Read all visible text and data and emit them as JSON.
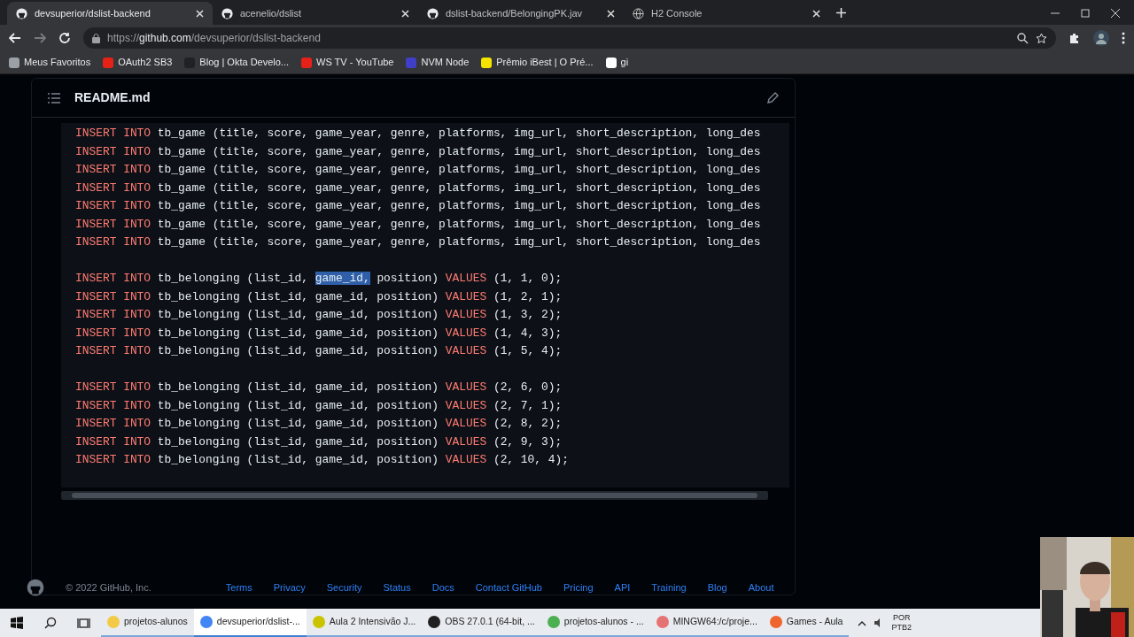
{
  "tabs": [
    {
      "title": "devsuperior/dslist-backend",
      "selected": true
    },
    {
      "title": "acenelio/dslist",
      "selected": false
    },
    {
      "title": "dslist-backend/BelongingPK.jav",
      "selected": false
    },
    {
      "title": "H2 Console",
      "selected": false
    }
  ],
  "address": {
    "scheme": "https://",
    "host": "github.com",
    "path": "/devsuperior/dslist-backend"
  },
  "bookmarks": [
    {
      "label": "Meus Favoritos",
      "color": "#9aa0a6"
    },
    {
      "label": "OAuth2 SB3",
      "color": "#e62117"
    },
    {
      "label": "Blog | Okta Develo...",
      "color": "#202124"
    },
    {
      "label": "WS TV - YouTube",
      "color": "#e62117"
    },
    {
      "label": "NVM Node",
      "color": "#3f3fc8"
    },
    {
      "label": "Prêmio iBest | O Pré...",
      "color": "#f5e400"
    },
    {
      "label": "gi",
      "color": "#ffffff"
    }
  ],
  "readme": {
    "title": "README.md",
    "blocks": [
      [
        [
          {
            "t": "INSERT INTO",
            "kind": "keyword"
          },
          {
            "t": " tb_game (title, score, game_year, genre, platforms, img_url, short_description, long_des",
            "kind": "plain"
          }
        ],
        [
          {
            "t": "INSERT INTO",
            "kind": "keyword"
          },
          {
            "t": " tb_game (title, score, game_year, genre, platforms, img_url, short_description, long_des",
            "kind": "plain"
          }
        ],
        [
          {
            "t": "INSERT INTO",
            "kind": "keyword"
          },
          {
            "t": " tb_game (title, score, game_year, genre, platforms, img_url, short_description, long_des",
            "kind": "plain"
          }
        ],
        [
          {
            "t": "INSERT INTO",
            "kind": "keyword"
          },
          {
            "t": " tb_game (title, score, game_year, genre, platforms, img_url, short_description, long_des",
            "kind": "plain"
          }
        ],
        [
          {
            "t": "INSERT INTO",
            "kind": "keyword"
          },
          {
            "t": " tb_game (title, score, game_year, genre, platforms, img_url, short_description, long_des",
            "kind": "plain"
          }
        ],
        [
          {
            "t": "INSERT INTO",
            "kind": "keyword"
          },
          {
            "t": " tb_game (title, score, game_year, genre, platforms, img_url, short_description, long_des",
            "kind": "plain"
          }
        ],
        [
          {
            "t": "INSERT INTO",
            "kind": "keyword"
          },
          {
            "t": " tb_game (title, score, game_year, genre, platforms, img_url, short_description, long_des",
            "kind": "plain"
          }
        ]
      ],
      [
        [
          {
            "t": "INSERT INTO",
            "kind": "keyword"
          },
          {
            "t": " tb_belonging (list_id, ",
            "kind": "plain"
          },
          {
            "t": "game_id,",
            "kind": "selected"
          },
          {
            "t": " position) ",
            "kind": "plain"
          },
          {
            "t": "VALUES",
            "kind": "keyword"
          },
          {
            "t": " (1, 1, 0);",
            "kind": "plain"
          }
        ],
        [
          {
            "t": "INSERT INTO",
            "kind": "keyword"
          },
          {
            "t": " tb_belonging (list_id, game_id, position) ",
            "kind": "plain"
          },
          {
            "t": "VALUES",
            "kind": "keyword"
          },
          {
            "t": " (1, 2, 1);",
            "kind": "plain"
          }
        ],
        [
          {
            "t": "INSERT INTO",
            "kind": "keyword"
          },
          {
            "t": " tb_belonging (list_id, game_id, position) ",
            "kind": "plain"
          },
          {
            "t": "VALUES",
            "kind": "keyword"
          },
          {
            "t": " (1, 3, 2);",
            "kind": "plain"
          }
        ],
        [
          {
            "t": "INSERT INTO",
            "kind": "keyword"
          },
          {
            "t": " tb_belonging (list_id, game_id, position) ",
            "kind": "plain"
          },
          {
            "t": "VALUES",
            "kind": "keyword"
          },
          {
            "t": " (1, 4, 3);",
            "kind": "plain"
          }
        ],
        [
          {
            "t": "INSERT INTO",
            "kind": "keyword"
          },
          {
            "t": " tb_belonging (list_id, game_id, position) ",
            "kind": "plain"
          },
          {
            "t": "VALUES",
            "kind": "keyword"
          },
          {
            "t": " (1, 5, 4);",
            "kind": "plain"
          }
        ]
      ],
      [
        [
          {
            "t": "INSERT INTO",
            "kind": "keyword"
          },
          {
            "t": " tb_belonging (list_id, game_id, position) ",
            "kind": "plain"
          },
          {
            "t": "VALUES",
            "kind": "keyword"
          },
          {
            "t": " (2, 6, 0);",
            "kind": "plain"
          }
        ],
        [
          {
            "t": "INSERT INTO",
            "kind": "keyword"
          },
          {
            "t": " tb_belonging (list_id, game_id, position) ",
            "kind": "plain"
          },
          {
            "t": "VALUES",
            "kind": "keyword"
          },
          {
            "t": " (2, 7, 1);",
            "kind": "plain"
          }
        ],
        [
          {
            "t": "INSERT INTO",
            "kind": "keyword"
          },
          {
            "t": " tb_belonging (list_id, game_id, position) ",
            "kind": "plain"
          },
          {
            "t": "VALUES",
            "kind": "keyword"
          },
          {
            "t": " (2, 8, 2);",
            "kind": "plain"
          }
        ],
        [
          {
            "t": "INSERT INTO",
            "kind": "keyword"
          },
          {
            "t": " tb_belonging (list_id, game_id, position) ",
            "kind": "plain"
          },
          {
            "t": "VALUES",
            "kind": "keyword"
          },
          {
            "t": " (2, 9, 3);",
            "kind": "plain"
          }
        ],
        [
          {
            "t": "INSERT INTO",
            "kind": "keyword"
          },
          {
            "t": " tb_belonging (list_id, game_id, position) ",
            "kind": "plain"
          },
          {
            "t": "VALUES",
            "kind": "keyword"
          },
          {
            "t": " (2, 10, 4);",
            "kind": "plain"
          }
        ]
      ]
    ]
  },
  "footer": {
    "copyright": "© 2022 GitHub, Inc.",
    "links": [
      "Terms",
      "Privacy",
      "Security",
      "Status",
      "Docs",
      "Contact GitHub",
      "Pricing",
      "API",
      "Training",
      "Blog",
      "About"
    ]
  },
  "taskbar": {
    "apps": [
      {
        "label": "projetos-alunos",
        "color": "#f3c948",
        "selected": false
      },
      {
        "label": "devsuperior/dslist-...",
        "color": "#4285f4",
        "selected": true
      },
      {
        "label": "Aula 2 Intensivão J...",
        "color": "#c9c300",
        "selected": false
      },
      {
        "label": "OBS 27.0.1 (64-bit, ...",
        "color": "#202020",
        "selected": false
      },
      {
        "label": "projetos-alunos - ...",
        "color": "#4caf50",
        "selected": false
      },
      {
        "label": "MINGW64:/c/proje...",
        "color": "#e57373",
        "selected": false
      },
      {
        "label": "Games - Aula",
        "color": "#f0652f",
        "selected": false
      }
    ],
    "language": "POR",
    "layout": "PTB2"
  }
}
